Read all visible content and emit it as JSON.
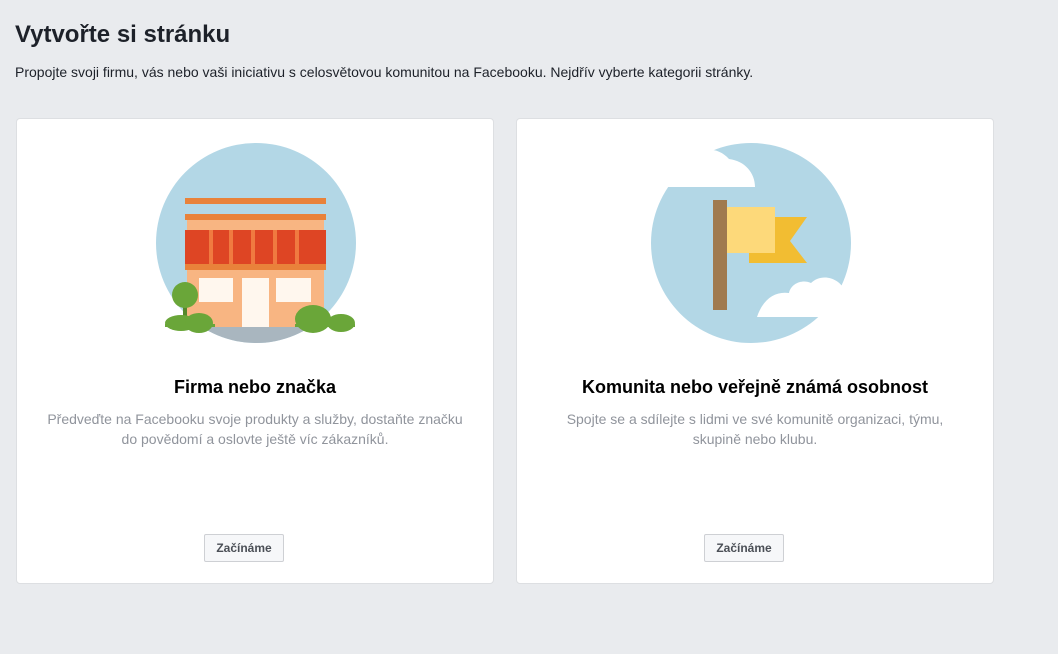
{
  "header": {
    "title": "Vytvořte si stránku",
    "subtitle": "Propojte svoji firmu, vás nebo vaši iniciativu s celosvětovou komunitou na Facebooku. Nejdřív vyberte kategorii stránky."
  },
  "cards": [
    {
      "icon": "storefront-illustration",
      "title": "Firma nebo značka",
      "description": "Předveďte na Facebooku svoje produkty a služby, dostaňte značku do povědomí a oslovte ještě víc zákazníků.",
      "button_label": "Začínáme"
    },
    {
      "icon": "flag-illustration",
      "title": "Komunita nebo veřejně známá osobnost",
      "description": "Spojte se a sdílejte s lidmi ve své komunitě organizaci, týmu, skupině nebo klubu.",
      "button_label": "Začínáme"
    }
  ],
  "colors": {
    "background": "#e9ebee",
    "card": "#ffffff",
    "circle": "#b3d7e6",
    "awning": "#de4524",
    "trim": "#e9823a",
    "building": "#f8b582",
    "bush": "#6aa639",
    "flag_front": "#fdd97a",
    "flag_back": "#f2bd32",
    "pole": "#a07a4f"
  }
}
